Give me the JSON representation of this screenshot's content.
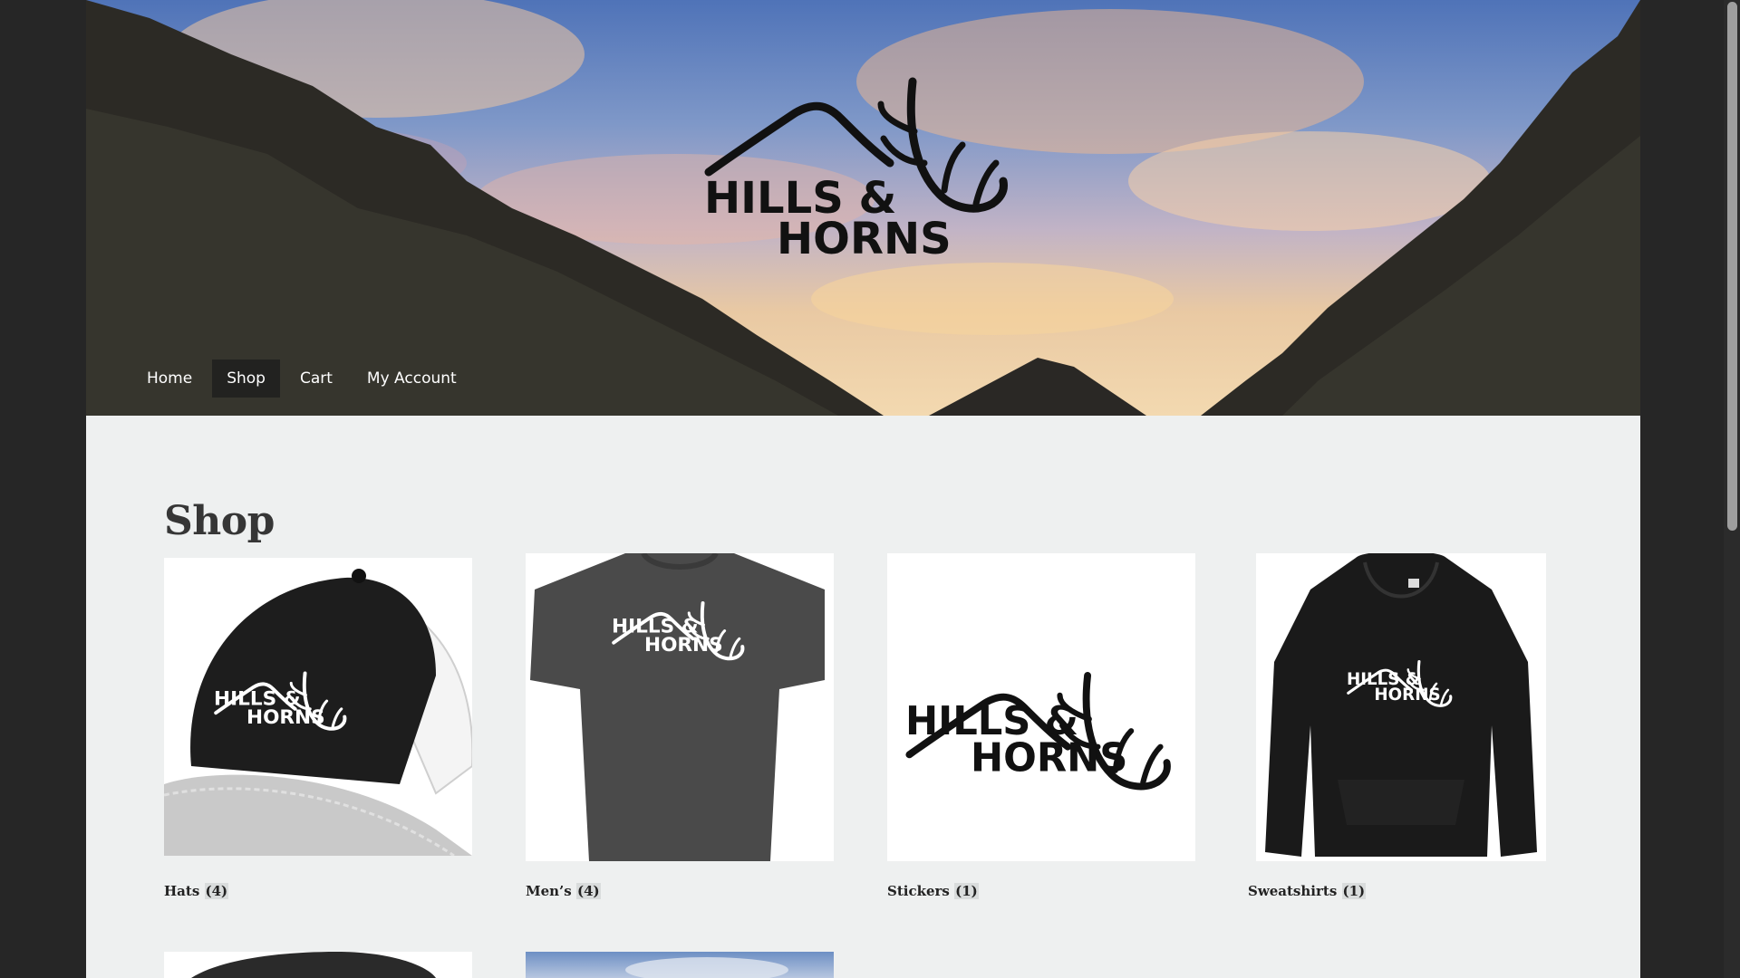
{
  "brand": {
    "line1": "HILLS &",
    "line2": "HORNS"
  },
  "nav": {
    "items": [
      {
        "label": "Home",
        "active": false
      },
      {
        "label": "Shop",
        "active": true
      },
      {
        "label": "Cart",
        "active": false
      },
      {
        "label": "My Account",
        "active": false
      }
    ]
  },
  "page": {
    "title": "Shop"
  },
  "categories": [
    {
      "name": "Hats",
      "count": "(4)",
      "image": "black trucker hat with white mesh and logo"
    },
    {
      "name": "Men’s",
      "count": "(4)",
      "image": "dark gray t-shirt with logo"
    },
    {
      "name": "Stickers",
      "count": "(1)",
      "image": "logo sticker"
    },
    {
      "name": "Sweatshirts",
      "count": "(1)",
      "image": "black hoodie with logo"
    }
  ],
  "colors": {
    "page_background": "#262626",
    "content_background": "#eef0f0",
    "nav_active_background": "#1e1e1e",
    "logo_color": "#111111",
    "heading_color": "#363636"
  }
}
